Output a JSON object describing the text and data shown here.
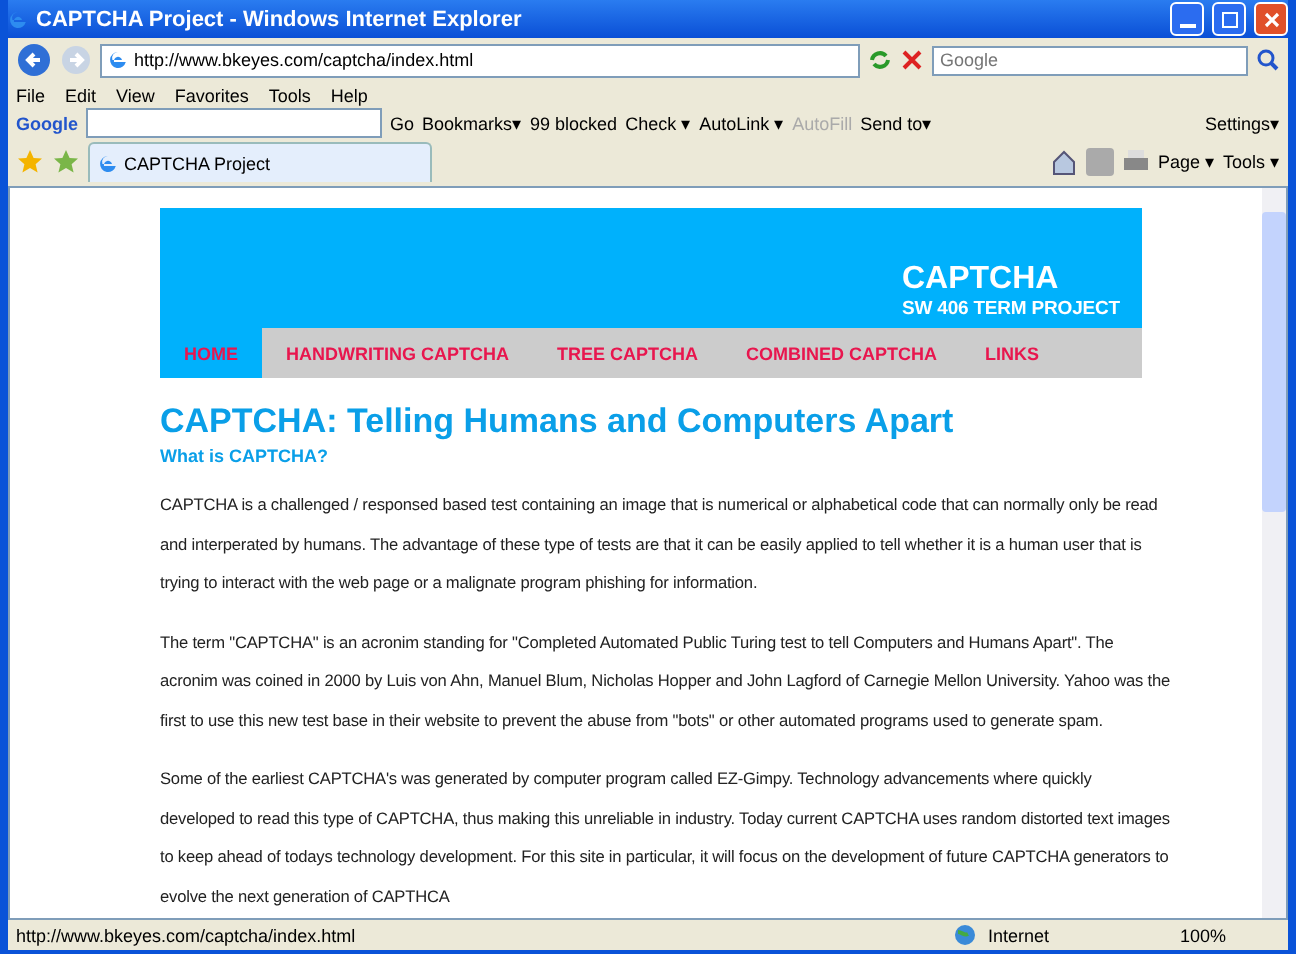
{
  "window": {
    "title": "CAPTCHA Project - Windows Internet Explorer"
  },
  "address_bar": {
    "url": "http://www.bkeyes.com/captcha/index.html",
    "search_placeholder": "Google"
  },
  "menu": [
    "File",
    "Edit",
    "View",
    "Favorites",
    "Tools",
    "Help"
  ],
  "google_toolbar": {
    "logo": "Google",
    "go": "Go",
    "items": [
      "Bookmarks▾",
      "99 blocked",
      "Check ▾",
      "AutoLink ▾",
      "AutoFill",
      "Send to▾"
    ],
    "settings": "Settings▾"
  },
  "tabs": [
    {
      "label": "CAPTCHA Project",
      "selected": true
    }
  ],
  "command_bar": [
    "Page ▾",
    "Tools ▾"
  ],
  "page": {
    "banner": {
      "title": "CAPTCHA",
      "subtitle": "SW 406 TERM PROJECT"
    },
    "nav": [
      {
        "label": "HOME",
        "selected": true
      },
      {
        "label": "HANDWRITING CAPTCHA",
        "selected": false
      },
      {
        "label": "TREE CAPTCHA",
        "selected": false
      },
      {
        "label": "COMBINED CAPTCHA",
        "selected": false
      },
      {
        "label": "LINKS",
        "selected": false
      }
    ],
    "heading": "CAPTCHA: Telling Humans and Computers Apart",
    "subheading": "What is CAPTCHA?",
    "paragraphs": [
      "CAPTCHA is a challenged / responsed based test containing an image that is numerical or alphabetical code that can normally only be read and interperated by humans. The advantage of these type of tests are that it can be easily applied to tell whether it is a human user that is trying to interact with the web page or a malignate program phishing for information.",
      "The term \"CAPTCHA\" is an acronim standing for \"Completed Automated Public Turing test to tell Computers and Humans Apart\". The acronim was coined in 2000 by Luis von Ahn, Manuel Blum, Nicholas Hopper and John Lagford of Carnegie Mellon University. Yahoo was the first to use this new test base in their website to prevent the abuse from \"bots\" or other automated programs used to generate spam.",
      "Some of the earliest CAPTCHA's was generated by computer program called EZ-Gimpy. Technology advancements where quickly developed to read this type of CAPTCHA, thus making this unreliable in industry. Today current CAPTCHA uses random distorted text images to keep ahead of todays technology development. For this site in particular, it will focus on the development of future CAPTCHA generators to evolve the next generation of CAPTHCA"
    ]
  },
  "status_bar": {
    "url": "http://www.bkeyes.com/captcha/index.html",
    "zone": "Internet",
    "zoom": "100%"
  }
}
